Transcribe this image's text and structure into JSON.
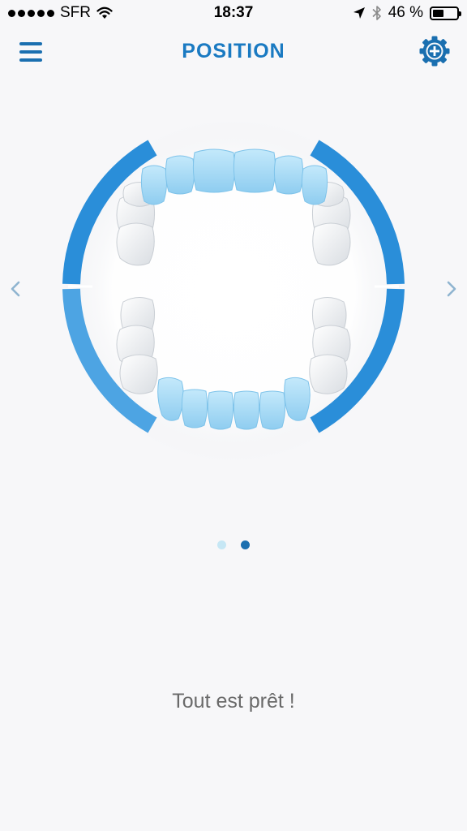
{
  "status_bar": {
    "carrier": "SFR",
    "time": "18:37",
    "battery_text": "46 %",
    "battery_level": 0.46,
    "icons": [
      "signal-dots",
      "wifi-icon",
      "location-arrow-icon",
      "bluetooth-icon",
      "battery-icon"
    ]
  },
  "nav": {
    "title": "POSITION",
    "left_icon": "hamburger-menu-icon",
    "right_icon": "gear-plus-icon"
  },
  "carousel": {
    "left_icon": "chevron-left-icon",
    "right_icon": "chevron-right-icon",
    "illustration": "teeth-icon",
    "page_count": 2,
    "active_page": 2
  },
  "message": "Tout est prêt !",
  "colors": {
    "accent": "#1a7ac2",
    "arc": "#2b8fd8",
    "tooth_blue": "#a9dbf5",
    "tooth_white": "#f2f4f6",
    "dot_active": "#1a6fb0",
    "dot_inactive": "#c6e7f5",
    "background": "#f7f7f9"
  }
}
